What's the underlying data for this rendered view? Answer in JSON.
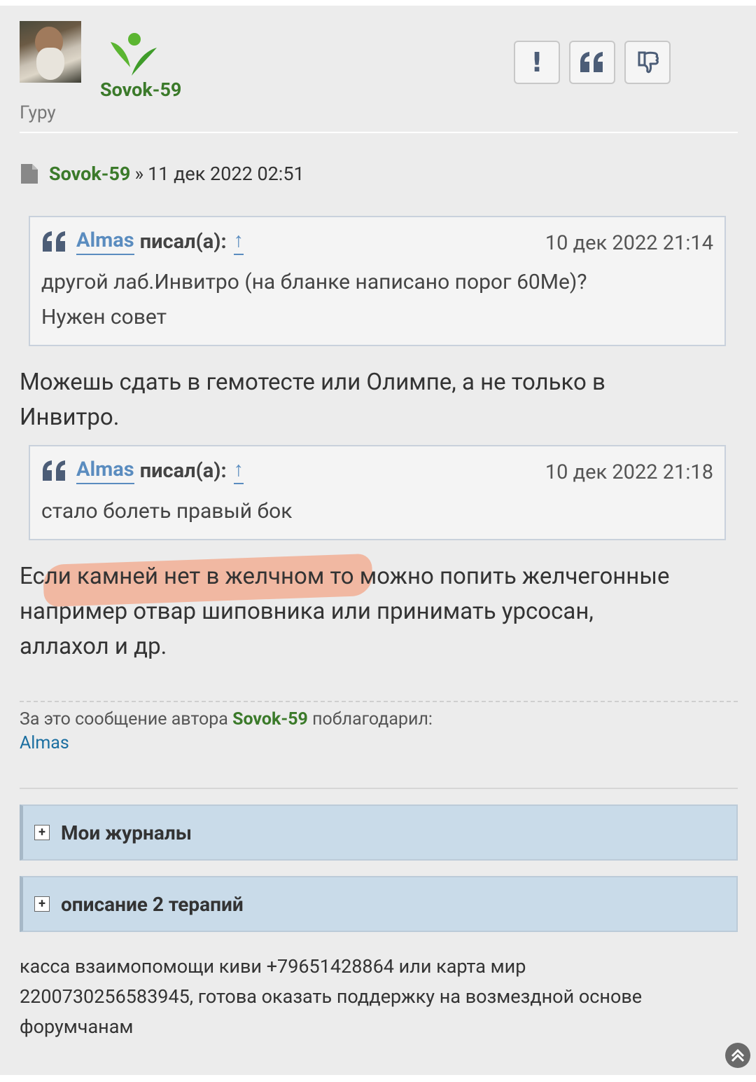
{
  "profile": {
    "username": "Sovok-59",
    "rank": "Гуру"
  },
  "actions": {
    "report": "!",
    "quote": "66",
    "dislike": "thumbs-down-icon"
  },
  "post_meta": {
    "author": "Sovok-59",
    "separator": "»",
    "date": "11 дек 2022 02:51"
  },
  "quotes": [
    {
      "author": "Almas",
      "wrote": "писал(а):",
      "up": "↑",
      "date": "10 дек 2022 21:14",
      "text_line1": "другой лаб.Инвитро (на бланке написано порог 60Ме)?",
      "text_line2": "Нужен совет"
    },
    {
      "author": "Almas",
      "wrote": "писал(а):",
      "up": "↑",
      "date": "10 дек 2022 21:18",
      "text_line1": "стало болеть правый бок"
    }
  ],
  "body": {
    "p1_line1": "Можешь сдать в гемотесте или Олимпе, а не только в",
    "p1_line2": "Инвитро.",
    "p2_line1": "Если камней нет в желчном то можно попить желчегонные",
    "p2_line2": "например отвар шиповника или принимать урсосан,",
    "p2_line3": "аллахол и др."
  },
  "thanks": {
    "prefix": "За это сообщение автора",
    "author": "Sovok-59",
    "suffix": "поблагодарил:",
    "user": "Almas"
  },
  "spoilers": [
    {
      "label": "Мои журналы",
      "toggle": "+"
    },
    {
      "label": "описание 2 терапий",
      "toggle": "+"
    }
  ],
  "signature": {
    "line1": "касса взаимопомощи киви +79651428864 или карта мир",
    "line2": "2200730256583945, готова оказать поддержку на возмездной основе",
    "line3": "форумчанам"
  },
  "colors": {
    "username_green": "#3b7a2a",
    "quote_author_blue": "#5a8cbf",
    "link_blue": "#1a6ea0",
    "spoiler_bg": "#c9dbe9",
    "highlight": "#f4a283"
  }
}
